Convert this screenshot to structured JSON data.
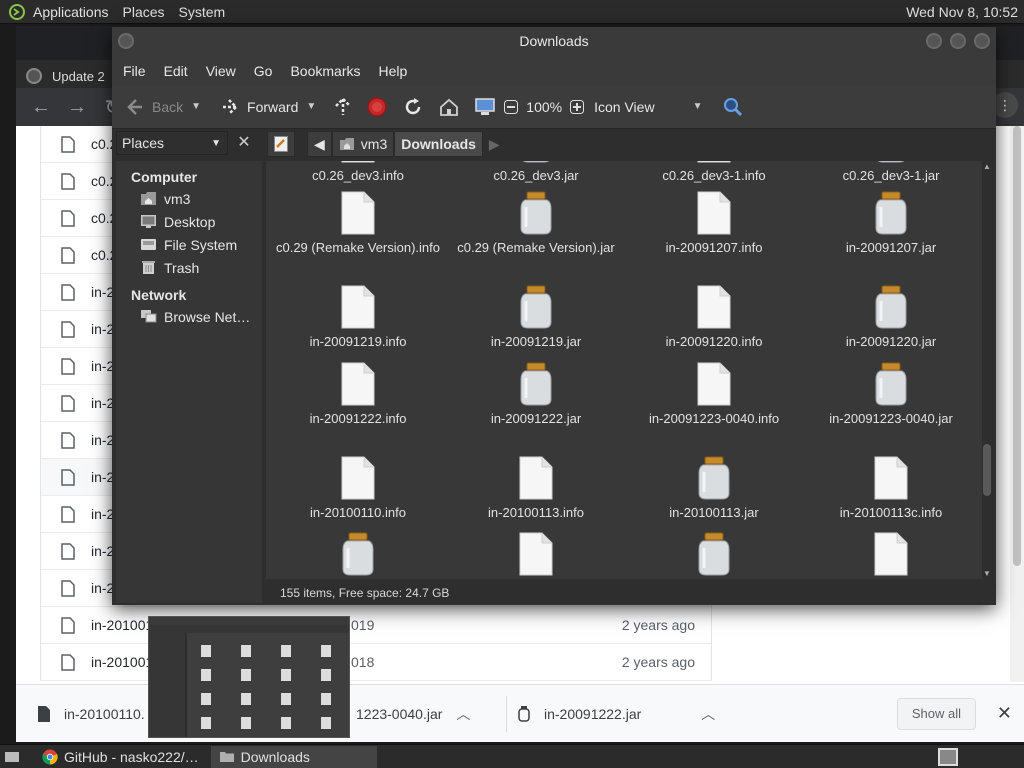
{
  "top_panel": {
    "menus": [
      "Applications",
      "Places",
      "System"
    ],
    "clock": "Wed Nov  8, 10:52"
  },
  "chrome": {
    "tab_title": "Update 2",
    "files": [
      {
        "name": "c0.2"
      },
      {
        "name": "c0.2"
      },
      {
        "name": "c0.2"
      },
      {
        "name": "c0.2"
      },
      {
        "name": "in-2"
      },
      {
        "name": "in-2"
      },
      {
        "name": "in-2"
      },
      {
        "name": "in-2"
      },
      {
        "name": "in-2"
      },
      {
        "name": "in-2"
      },
      {
        "name": "in-2"
      },
      {
        "name": "in-2"
      },
      {
        "name": "in-2"
      },
      {
        "name": "in-201001",
        "commit": "019",
        "age": "2 years ago"
      },
      {
        "name": "in-201001",
        "commit": "018",
        "age": "2 years ago"
      }
    ],
    "downloads_bar": {
      "items": [
        {
          "name": "in-20100110."
        },
        {
          "name": "1223-0040.jar"
        },
        {
          "name": "in-20091222.jar"
        }
      ],
      "show_all": "Show all",
      "close": "✕"
    }
  },
  "caja": {
    "title": "Downloads",
    "menus": [
      "File",
      "Edit",
      "View",
      "Go",
      "Bookmarks",
      "Help"
    ],
    "toolbar": {
      "back": "Back",
      "forward": "Forward",
      "zoom": "100%",
      "view_mode": "Icon View"
    },
    "sidebar_selector": "Places",
    "breadcrumbs": [
      "vm3",
      "Downloads"
    ],
    "sidebar": {
      "sections": [
        {
          "heading": "Computer",
          "items": [
            {
              "label": "vm3",
              "icon": "home-folder-icon"
            },
            {
              "label": "Desktop",
              "icon": "desktop-icon"
            },
            {
              "label": "File System",
              "icon": "drive-icon"
            },
            {
              "label": "Trash",
              "icon": "trash-icon"
            }
          ]
        },
        {
          "heading": "Network",
          "items": [
            {
              "label": "Browse Net…",
              "icon": "network-icon"
            }
          ]
        }
      ]
    },
    "files": [
      {
        "name": "c0.26_dev3.info",
        "type": "info"
      },
      {
        "name": "c0.26_dev3.jar",
        "type": "jar"
      },
      {
        "name": "c0.26_dev3-1.info",
        "type": "info"
      },
      {
        "name": "c0.26_dev3-1.jar",
        "type": "jar"
      },
      {
        "name": "c0.29 (Remake Version).info",
        "type": "info"
      },
      {
        "name": "c0.29 (Remake Version).jar",
        "type": "jar"
      },
      {
        "name": "in-20091207.info",
        "type": "info"
      },
      {
        "name": "in-20091207.jar",
        "type": "jar"
      },
      {
        "name": "in-20091219.info",
        "type": "info"
      },
      {
        "name": "in-20091219.jar",
        "type": "jar"
      },
      {
        "name": "in-20091220.info",
        "type": "info"
      },
      {
        "name": "in-20091220.jar",
        "type": "jar"
      },
      {
        "name": "in-20091222.info",
        "type": "info"
      },
      {
        "name": "in-20091222.jar",
        "type": "jar"
      },
      {
        "name": "in-20091223-0040.info",
        "type": "info"
      },
      {
        "name": "in-20091223-0040.jar",
        "type": "jar"
      },
      {
        "name": "in-20100110.info",
        "type": "info"
      },
      {
        "name": "in-20100113.info",
        "type": "info"
      },
      {
        "name": "in-20100113.jar",
        "type": "jar"
      },
      {
        "name": "in-20100113c.info",
        "type": "info"
      },
      {
        "name": "",
        "type": "jar"
      },
      {
        "name": "",
        "type": "info"
      },
      {
        "name": "",
        "type": "jar"
      },
      {
        "name": "",
        "type": "info"
      }
    ],
    "status": "155 items, Free space: 24.7 GB"
  },
  "taskbar": {
    "items": [
      {
        "label": "GitHub - nasko222/…",
        "icon": "chrome-icon"
      },
      {
        "label": "Downloads",
        "icon": "folder-icon"
      }
    ]
  }
}
